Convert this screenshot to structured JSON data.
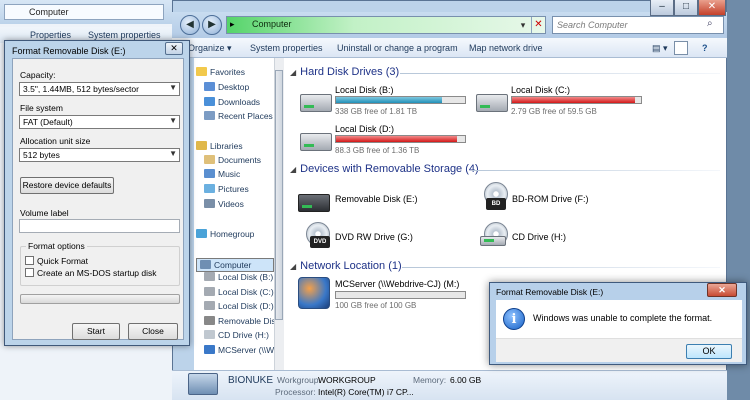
{
  "background_window": {
    "address": "Computer",
    "toolbar": [
      "Properties",
      "System properties"
    ]
  },
  "explorer": {
    "address": "Computer",
    "search_placeholder": "Search Computer",
    "commands": [
      "Organize",
      "System properties",
      "Uninstall or change a program",
      "Map network drive"
    ],
    "nav": [
      {
        "label": "Favorites",
        "color": "#f2c94c",
        "bold": false
      },
      {
        "label": "Desktop",
        "color": "#5b8fd6"
      },
      {
        "label": "Downloads",
        "color": "#4a90d9"
      },
      {
        "label": "Recent Places",
        "color": "#7c9cc4"
      },
      {
        "label": "Libraries",
        "color": "#e0b84a"
      },
      {
        "label": "Documents",
        "color": "#dfc07a"
      },
      {
        "label": "Music",
        "color": "#5a8fd0"
      },
      {
        "label": "Pictures",
        "color": "#6bb0e0"
      },
      {
        "label": "Videos",
        "color": "#7a8fa8"
      },
      {
        "label": "Homegroup",
        "color": "#4aa3d8"
      },
      {
        "label": "Computer",
        "color": "#6f8fb3"
      },
      {
        "label": "Local Disk (B:)",
        "color": "#a4aab2"
      },
      {
        "label": "Local Disk (C:)",
        "color": "#a4aab2"
      },
      {
        "label": "Local Disk (D:)",
        "color": "#a4aab2"
      },
      {
        "label": "Removable Disk (E:)",
        "color": "#888"
      },
      {
        "label": "CD Drive (H:)",
        "color": "#c0c8d0"
      },
      {
        "label": "MCServer (\\\\Webdrive-CJ) (M:)",
        "color": "#3a78c8"
      }
    ],
    "sections": {
      "hdd": "Hard Disk Drives (3)",
      "removable": "Devices with Removable Storage (4)",
      "network": "Network Location (1)"
    },
    "drives": [
      {
        "name": "Local Disk (B:)",
        "free": "338 GB free of 1.81 TB",
        "used_fraction": 0.82,
        "bar": "blue"
      },
      {
        "name": "Local Disk (C:)",
        "free": "2.79 GB free of 59.5 GB",
        "used_fraction": 0.95,
        "bar": "red"
      },
      {
        "name": "Local Disk (D:)",
        "free": "88.3 GB free of 1.36 TB",
        "used_fraction": 0.94,
        "bar": "red"
      }
    ],
    "removable": [
      {
        "name": "Removable Disk (E:)"
      },
      {
        "name": "BD-ROM Drive (F:)",
        "badge": "BD"
      },
      {
        "name": "DVD RW Drive (G:)",
        "badge": "DVD"
      },
      {
        "name": "CD Drive (H:)"
      }
    ],
    "network": {
      "name": "MCServer (\\\\Webdrive-CJ) (M:)",
      "free": "100 GB free of 100 GB",
      "used_fraction": 0.0
    },
    "status": {
      "computer": "BIONUKE",
      "workgroup_label": "Workgroup:",
      "workgroup": "WORKGROUP",
      "memory_label": "Memory:",
      "memory": "6.00 GB",
      "processor_label": "Processor:",
      "processor": "Intel(R) Core(TM) i7 CP..."
    }
  },
  "format_dialog": {
    "title": "Format Removable Disk (E:)",
    "capacity_label": "Capacity:",
    "capacity_value": "3.5\",  1.44MB, 512 bytes/sector",
    "fs_label": "File system",
    "fs_value": "FAT (Default)",
    "alloc_label": "Allocation unit size",
    "alloc_value": "512 bytes",
    "restore_button": "Restore device defaults",
    "volume_label": "Volume label",
    "volume_value": "",
    "options_label": "Format options",
    "quick_format": "Quick Format",
    "msdos": "Create an MS-DOS startup disk",
    "start": "Start",
    "close": "Close"
  },
  "message_box": {
    "title": "Format Removable Disk (E:)",
    "text": "Windows was unable to complete the format.",
    "ok": "OK"
  }
}
